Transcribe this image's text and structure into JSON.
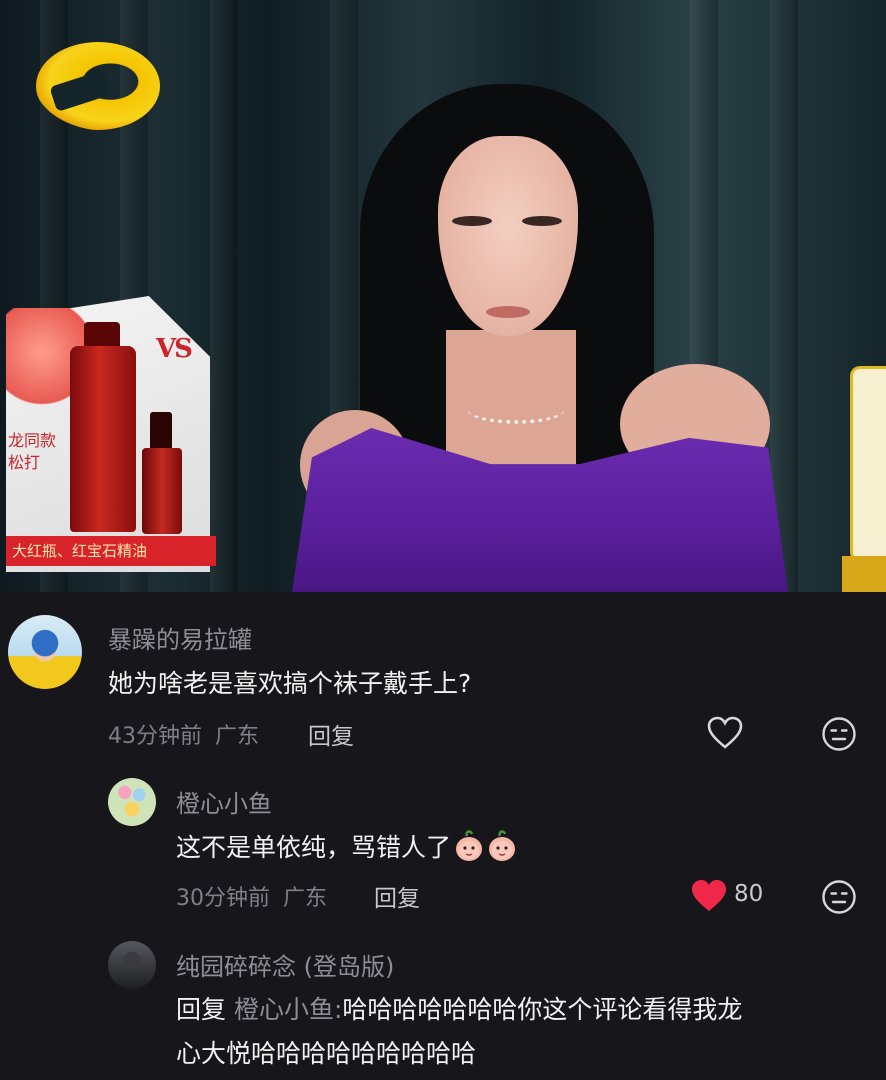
{
  "video": {
    "ad_logo": "VS",
    "ad_banner": "大红瓶、红宝石精油",
    "ad_side_lines": [
      "龙同款",
      "松打"
    ]
  },
  "comments": [
    {
      "username": "暴躁的易拉罐",
      "text": "她为啥老是喜欢搞个袜子戴手上?",
      "time": "43分钟前",
      "location": "广东",
      "reply_label": "回复",
      "liked": false
    },
    {
      "username": "橙心小鱼",
      "text": "这不是单依纯，骂错人了",
      "emoji": "peach-emoji",
      "time": "30分钟前",
      "location": "广东",
      "reply_label": "回复",
      "liked": true,
      "like_count": "80",
      "like_color": "#f0284a"
    },
    {
      "username": "纯园碎碎念 (登岛版)",
      "reply_prefix": "回复",
      "reply_target": "橙心小鱼:",
      "text_line1": "哈哈哈哈哈哈哈你这个评论看得我龙",
      "text_line2": "心大悦哈哈哈哈哈哈哈哈哈"
    }
  ]
}
